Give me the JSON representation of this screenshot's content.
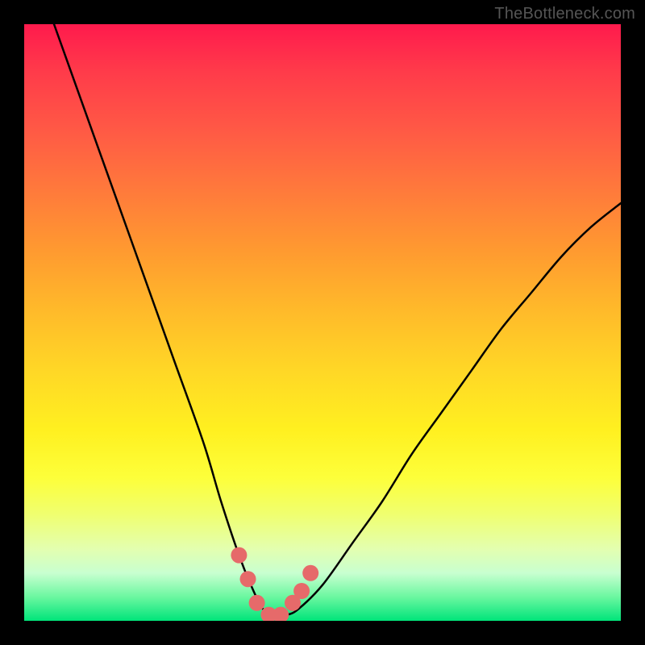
{
  "watermark": "TheBottleneck.com",
  "colors": {
    "frame": "#000000",
    "curve_stroke": "#000000",
    "marker_fill": "#e66a6a",
    "gradient_top": "#ff1a4d",
    "gradient_bottom": "#00e47a"
  },
  "chart_data": {
    "type": "line",
    "title": "",
    "xlabel": "",
    "ylabel": "",
    "xlim": [
      0,
      100
    ],
    "ylim": [
      0,
      100
    ],
    "note": "Axes are unlabeled in the source image; x and y are normalized 0–100. y=0 is the green bottom edge, y=100 is the red top edge.",
    "series": [
      {
        "name": "main-curve",
        "x": [
          5,
          10,
          15,
          20,
          25,
          30,
          33,
          36,
          38,
          40,
          42,
          44,
          46,
          50,
          55,
          60,
          65,
          70,
          75,
          80,
          85,
          90,
          95,
          100
        ],
        "y": [
          100,
          86,
          72,
          58,
          44,
          30,
          20,
          11,
          6,
          2,
          1,
          1,
          2,
          6,
          13,
          20,
          28,
          35,
          42,
          49,
          55,
          61,
          66,
          70
        ]
      }
    ],
    "markers": {
      "name": "valley-points",
      "x": [
        36,
        37.5,
        39,
        41,
        43,
        45,
        46.5,
        48
      ],
      "y": [
        11,
        7,
        3,
        1,
        1,
        3,
        5,
        8
      ]
    }
  }
}
